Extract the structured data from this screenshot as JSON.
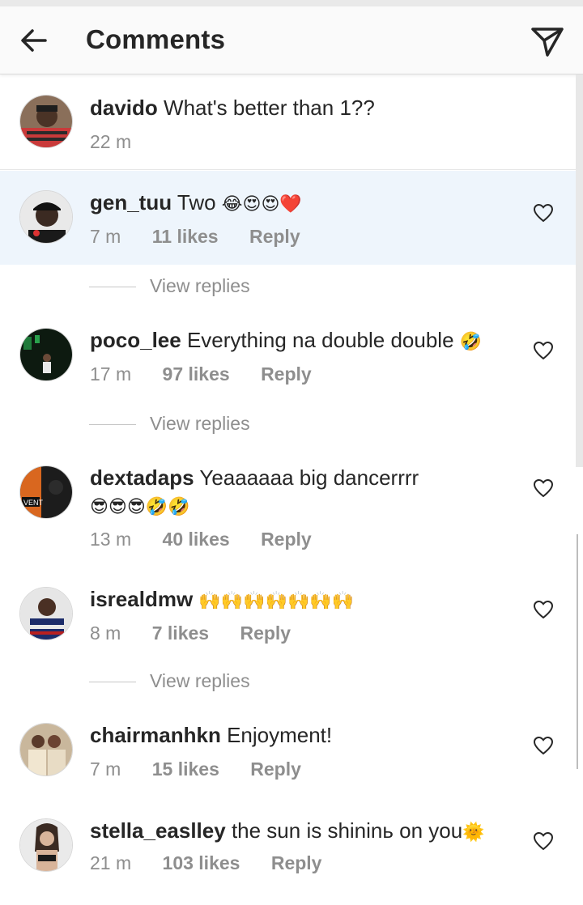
{
  "header": {
    "title": "Comments",
    "back_icon": "arrow-left-icon",
    "share_icon": "paper-plane-icon"
  },
  "caption": {
    "username": "davido",
    "text": "What's better than 1??",
    "time": "22 m"
  },
  "comments": [
    {
      "username": "gen_tuu",
      "text": "Two",
      "emoji": "😂😍😍❤️",
      "time": "7 m",
      "likes": "11 likes",
      "reply": "Reply",
      "view_replies": "View replies"
    },
    {
      "username": "poco_lee",
      "text": "Everything na double double",
      "emoji": "🤣",
      "time": "17 m",
      "likes": "97 likes",
      "reply": "Reply",
      "view_replies": "View replies"
    },
    {
      "username": "dextadaps",
      "text": "Yeaaaaaa big dancerrrr",
      "emoji": "😎😎😎🤣🤣",
      "time": "13 m",
      "likes": "40 likes",
      "reply": "Reply"
    },
    {
      "username": "isrealdmw",
      "text": "",
      "emoji": "🙌🙌🙌🙌🙌🙌🙌",
      "time": "8 m",
      "likes": "7 likes",
      "reply": "Reply",
      "view_replies": "View replies"
    },
    {
      "username": "chairmanhkn",
      "text": "Enjoyment!",
      "emoji": "",
      "time": "7 m",
      "likes": "15 likes",
      "reply": "Reply"
    },
    {
      "username": "stella_easlley",
      "text": "the sun is shininь on you",
      "emoji": "🌞",
      "time": "21 m",
      "likes": "103 likes",
      "reply": "Reply"
    }
  ],
  "avatar_texts": {
    "dextadaps": "VENT"
  },
  "colors": {
    "highlight": "#eef5fc",
    "muted": "#8e8e8e",
    "text": "#262626",
    "heart_outline": "#262626"
  }
}
